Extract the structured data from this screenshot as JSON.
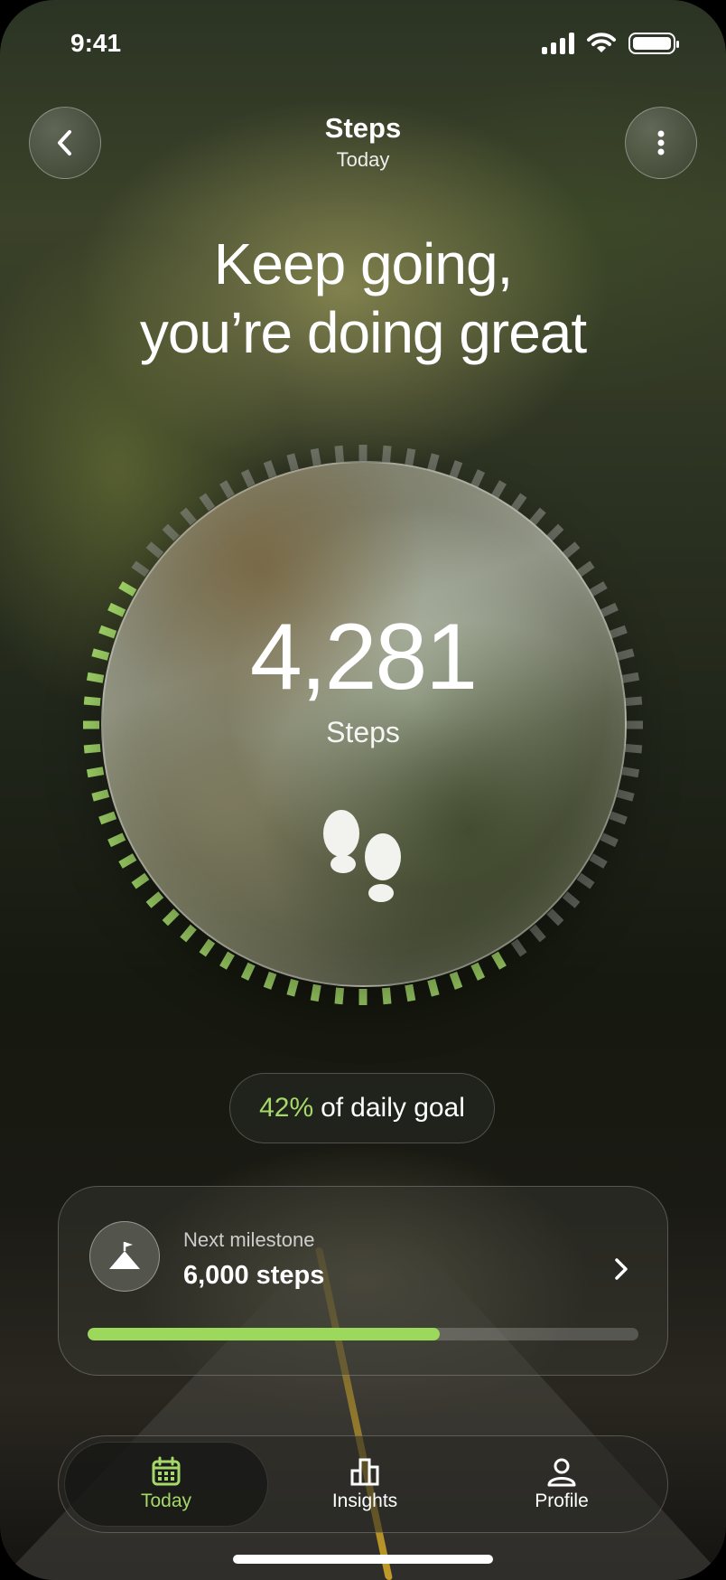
{
  "status_bar": {
    "time": "9:41"
  },
  "header": {
    "title": "Steps",
    "subtitle": "Today"
  },
  "headline": {
    "line1": "Keep going,",
    "line2": "you’re doing great"
  },
  "steps": {
    "count": "4,281",
    "label": "Steps",
    "progress_fraction": 0.42
  },
  "goal": {
    "percent": "42%",
    "of": "of",
    "rest": "daily goal"
  },
  "milestone": {
    "label": "Next milestone",
    "value": "6,000 steps",
    "progress_fraction": 0.64
  },
  "tabs": [
    {
      "label": "Today",
      "icon": "calendar-icon",
      "active": true
    },
    {
      "label": "Insights",
      "icon": "bar-chart-icon",
      "active": false
    },
    {
      "label": "Profile",
      "icon": "person-icon",
      "active": false
    }
  ],
  "colors": {
    "accent": "#a4d96a",
    "progress": "#9bd85c",
    "ring_inactive": "#8c8f86"
  }
}
